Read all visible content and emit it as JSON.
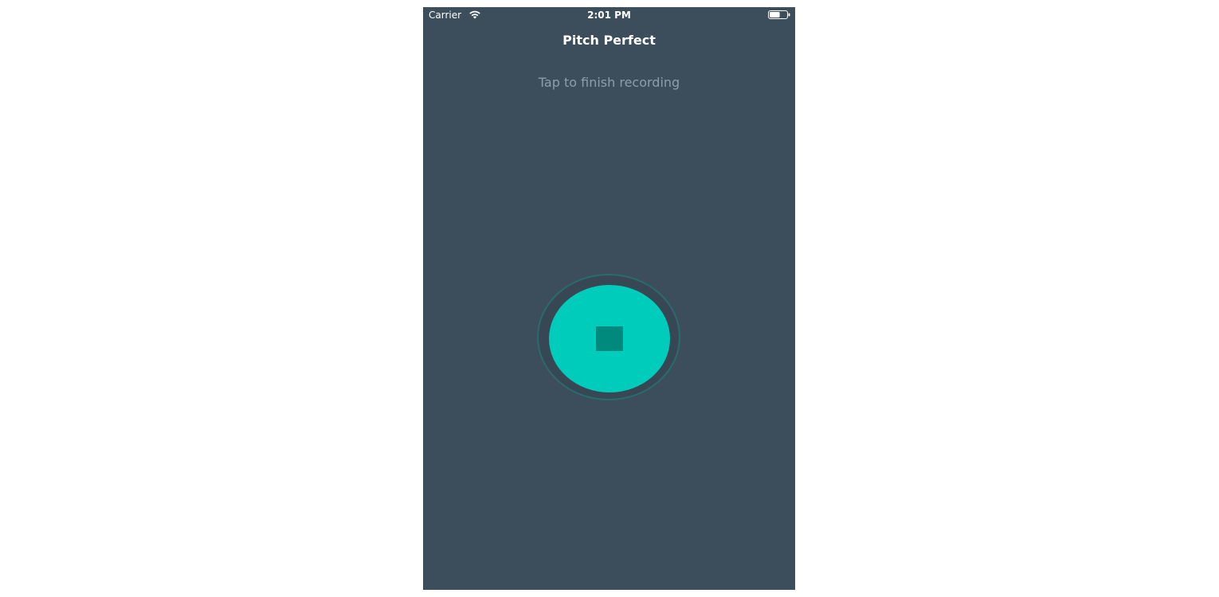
{
  "status_bar": {
    "carrier": "Carrier",
    "time": "2:01 PM",
    "wifi_icon": "wifi-icon",
    "battery_icon": "battery-icon",
    "battery_level": 0.6
  },
  "nav": {
    "title": "Pitch Perfect"
  },
  "main": {
    "recording_label": "Tap to finish recording",
    "stop_button_icon": "stop-icon"
  },
  "colors": {
    "background": "#3c4e5c",
    "accent": "#00ccbb",
    "stop_icon": "#008a7d",
    "label": "#8c9eaa"
  }
}
